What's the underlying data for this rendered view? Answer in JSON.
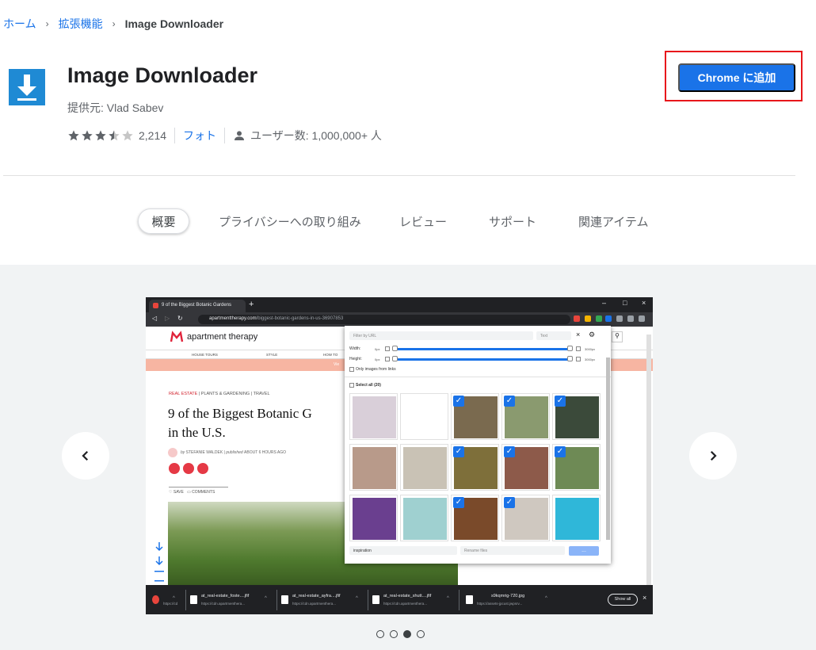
{
  "breadcrumb": {
    "home": "ホーム",
    "category": "拡張機能",
    "current": "Image Downloader",
    "separator": "›"
  },
  "extension": {
    "name": "Image Downloader",
    "provider": "提供元: Vlad Sabev",
    "rating": 3.5,
    "rating_count": "2,214",
    "category": "フォト",
    "users": "ユーザー数: 1,000,000+ 人",
    "icon": "download-arrow-icon",
    "icon_color": "#1f8ad4"
  },
  "add_button": {
    "label": "Chrome に追加",
    "color": "#1a73e8",
    "highlight_color": "#e8161b"
  },
  "tabs": [
    {
      "label": "概要",
      "active": true
    },
    {
      "label": "プライバシーへの取り組み",
      "active": false
    },
    {
      "label": "レビュー",
      "active": false
    },
    {
      "label": "サポート",
      "active": false
    },
    {
      "label": "関連アイテム",
      "active": false
    }
  ],
  "gallery": {
    "prev_icon": "chevron-left-icon",
    "next_icon": "chevron-right-icon",
    "slides": 4,
    "active_slide": 3,
    "screenshot": {
      "tab_title": "9 of the Biggest Botanic Gardens",
      "url_host": "apartmenttherapy.com",
      "url_path": "/biggest-botanic-gardens-in-us-36907853",
      "site_name": "apartment therapy",
      "nav": [
        "HOUSE TOURS",
        "STYLE",
        "HOW TO"
      ],
      "promo": "Vie",
      "category_primary": "REAL ESTATE",
      "category_rest": "| PLANTS & GARDENING | TRAVEL",
      "article_title_1": "9 of the Biggest Botanic G",
      "article_title_2": "in the U.S.",
      "byline_by": "by",
      "byline_author": "STEFANIE WALDEK",
      "byline_published": "published",
      "byline_time": "ABOUT 6 HOURS AGO",
      "save": "SAVE",
      "comments": "COMMENTS",
      "popup": {
        "filter_placeholder": "Filter by URL",
        "filter_mode": "Text",
        "width_label": "Width:",
        "height_label": "Height:",
        "min_label": "0px",
        "max_label": "3000px",
        "only_links": "Only images from links",
        "select_all": "Select all (20)",
        "folder_value": "inspiration",
        "rename_placeholder": "Rename files",
        "download_label": "...",
        "tiles": [
          {
            "checked": false,
            "color": "#d9cfd9"
          },
          {
            "checked": false,
            "color": "#ffffff"
          },
          {
            "checked": true,
            "color": "#7a6a4f"
          },
          {
            "checked": true,
            "color": "#8a9a6f"
          },
          {
            "checked": true,
            "color": "#3b4a3a"
          },
          {
            "checked": false,
            "color": "#b89a8a"
          },
          {
            "checked": false,
            "color": "#c9c2b5"
          },
          {
            "checked": true,
            "color": "#7e6f3a"
          },
          {
            "checked": true,
            "color": "#8d5a4a"
          },
          {
            "checked": true,
            "color": "#6e8a55"
          },
          {
            "checked": false,
            "color": "#6a3f8f"
          },
          {
            "checked": false,
            "color": "#9fd0d0"
          },
          {
            "checked": true,
            "color": "#7a4a2a"
          },
          {
            "checked": true,
            "color": "#cfc8c0"
          },
          {
            "checked": false,
            "color": "#2fb7d9"
          }
        ]
      },
      "downloads": [
        {
          "name": "",
          "src": "https://cd"
        },
        {
          "name": "at_real-estate_foste....jfif",
          "src": "https://cdn.apartmenthera..."
        },
        {
          "name": "at_real-estate_ayfra....jfif",
          "src": "https://cdn.apartmenthera..."
        },
        {
          "name": "at_real-estate_shutt....jfif",
          "src": "https://cdn.apartmenthera..."
        },
        {
          "name": "s9kqmrig-720.jpg",
          "src": "https://assets-jpcust.jwpsrv..."
        }
      ],
      "show_all": "Show all"
    }
  }
}
